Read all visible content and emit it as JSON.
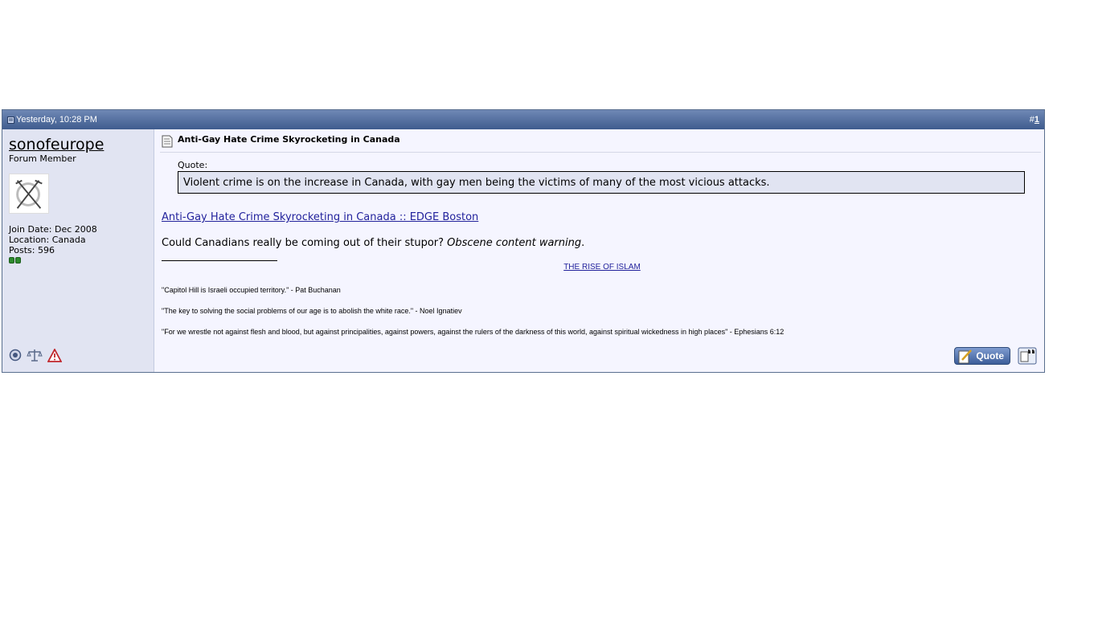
{
  "post": {
    "date": "Yesterday, 10:28 PM",
    "number_prefix": "#",
    "number": "1"
  },
  "user": {
    "name": "sonofeurope",
    "title": "Forum Member",
    "join_date": "Join Date: Dec 2008",
    "location": "Location: Canada",
    "posts": "Posts: 596"
  },
  "message": {
    "title": "Anti-Gay Hate Crime Skyrocketing in Canada",
    "quote_label": "Quote:",
    "quote_text": "Violent crime is on the increase in Canada, with gay men being the victims of many of the most vicious attacks.",
    "link_text": "Anti-Gay Hate Crime Skyrocketing in Canada :: EDGE Boston",
    "para_text": "Could Canadians really be coming out of their stupor?",
    "para_emphasis": "Obscene content warning",
    "para_end": "."
  },
  "signature": {
    "link_text": "THE RISE OF ISLAM",
    "lines": [
      "\"Capitol Hill is Israeli occupied territory.\" - Pat Buchanan",
      "\"The key to solving the social problems of our age is to abolish the white race.\" - Noel Ignatiev",
      "\"For we wrestle not against flesh and blood, but against principalities, against powers, against the rulers of the darkness of this world, against spiritual wickedness in high places\" - Ephesians 6:12"
    ]
  },
  "buttons": {
    "quote_label": "Quote"
  },
  "icons": {
    "post_icon": "document-icon",
    "status": "online-status-icon",
    "reputation": "reputation-scales-icon",
    "report": "report-warning-icon"
  },
  "colors": {
    "header_top": "#6f88b5",
    "header_bottom": "#3f5c8e",
    "sidebar_bg": "#e1e4f2",
    "content_bg": "#f5f5ff",
    "link": "#22229c",
    "reputation": "#2e8b2e"
  }
}
